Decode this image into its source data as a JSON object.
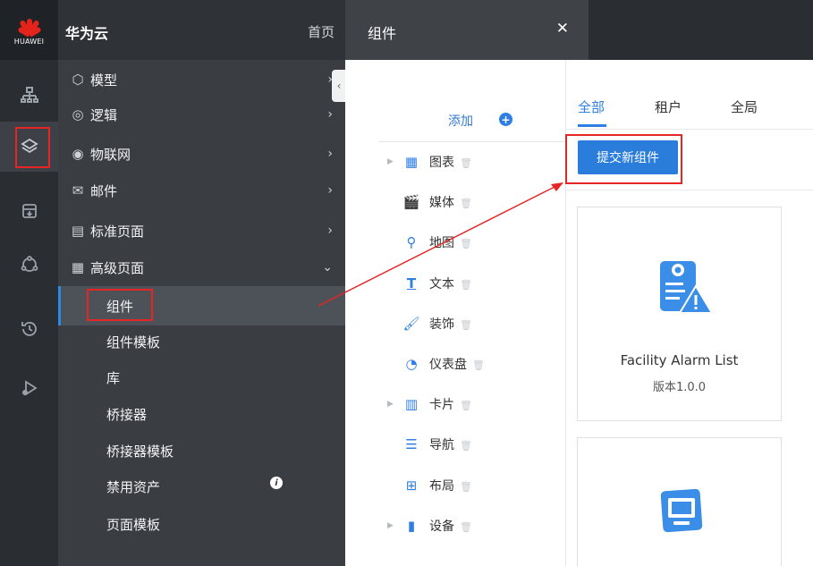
{
  "brand": {
    "logo_text": "HUAWEI",
    "app_title": "华为云",
    "home_link": "首页"
  },
  "rail": {
    "items": [
      {
        "icon": "sitemap-icon"
      },
      {
        "icon": "layers-icon",
        "active": true
      },
      {
        "icon": "download-box-icon"
      },
      {
        "icon": "circle-nodes-icon"
      },
      {
        "icon": "history-icon"
      },
      {
        "icon": "bug-play-icon"
      }
    ]
  },
  "nav": {
    "items": [
      {
        "label": "模型",
        "icon": "cube-icon",
        "chevron": "›"
      },
      {
        "label": "逻辑",
        "icon": "logic-icon",
        "chevron": "›"
      },
      {
        "label": "物联网",
        "icon": "iot-icon",
        "chevron": "›"
      },
      {
        "label": "邮件",
        "icon": "mail-icon",
        "chevron": "›"
      },
      {
        "label": "标准页面",
        "icon": "page-icon",
        "chevron": "›"
      },
      {
        "label": "高级页面",
        "icon": "advanced-page-icon",
        "chevron": "⌄"
      }
    ],
    "sub_items": [
      {
        "label": "组件",
        "selected": true
      },
      {
        "label": "组件模板"
      },
      {
        "label": "库"
      },
      {
        "label": "桥接器"
      },
      {
        "label": "桥接器模板"
      },
      {
        "label": "禁用资产"
      },
      {
        "label": "页面模板"
      }
    ]
  },
  "dialog": {
    "title": "组件",
    "close": "✕",
    "add_label": "添加",
    "categories": [
      {
        "label": "图表",
        "has_arrow": true,
        "icon": "chart-icon"
      },
      {
        "label": "媒体",
        "has_arrow": false,
        "icon": "media-icon"
      },
      {
        "label": "地图",
        "has_arrow": false,
        "icon": "map-icon"
      },
      {
        "label": "文本",
        "has_arrow": false,
        "icon": "text-icon"
      },
      {
        "label": "装饰",
        "has_arrow": false,
        "icon": "decoration-icon"
      },
      {
        "label": "仪表盘",
        "has_arrow": false,
        "icon": "dashboard-icon"
      },
      {
        "label": "卡片",
        "has_arrow": true,
        "icon": "card-icon"
      },
      {
        "label": "导航",
        "has_arrow": false,
        "icon": "navigation-icon"
      },
      {
        "label": "布局",
        "has_arrow": false,
        "icon": "layout-icon"
      },
      {
        "label": "设备",
        "has_arrow": true,
        "icon": "device-icon"
      }
    ],
    "tabs": [
      {
        "label": "全部",
        "active": true
      },
      {
        "label": "租户"
      },
      {
        "label": "全局"
      }
    ],
    "submit_button": "提交新组件",
    "cards": [
      {
        "name": "Facility Alarm List",
        "version": "版本1.0.0"
      }
    ]
  },
  "colors": {
    "accent": "#2e7ee3",
    "highlight_box": "#e62525",
    "sidebar_bg": "#3a3e43"
  }
}
